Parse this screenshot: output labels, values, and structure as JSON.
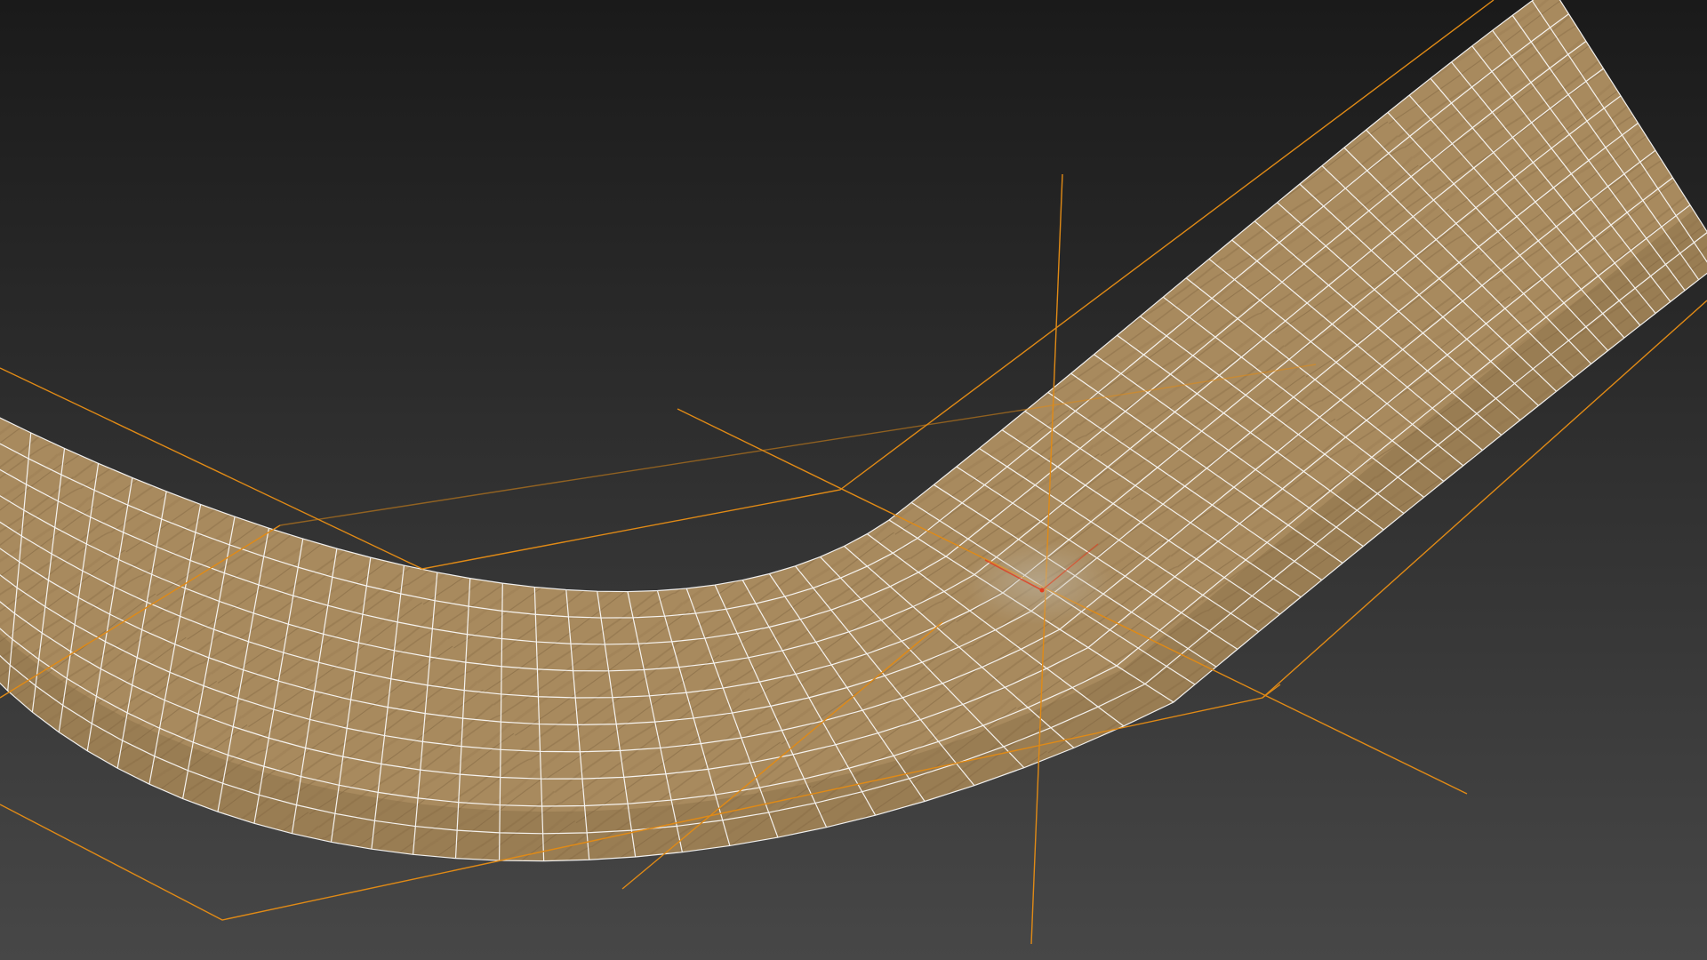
{
  "viewport": {
    "background_top_color": "#1a1a1a",
    "background_bottom_color": "#474747"
  },
  "scene": {
    "object": "curved-wooden-strip-mesh",
    "material": "wood-texture",
    "surface_color": "#a88a5e",
    "surface_shadow_color": "#7e6440",
    "wireframe_color": "#ffffff",
    "gizmo_color": "#e08a16",
    "pivot_color": "#e53c1e"
  }
}
